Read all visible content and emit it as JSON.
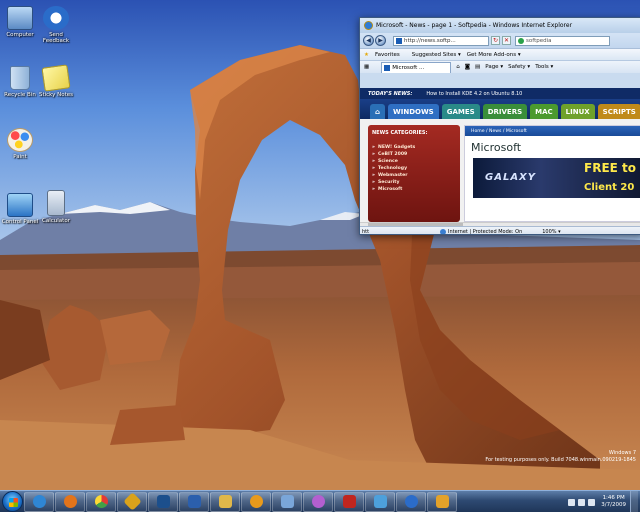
{
  "desktop": {
    "icons": [
      {
        "label": "Computer",
        "icon": "computer-icon"
      },
      {
        "label": "Send Feedback",
        "icon": "feedback-icon"
      },
      {
        "label": "Recycle Bin",
        "icon": "recycle-bin-icon"
      },
      {
        "label": "Sticky Notes",
        "icon": "sticky-notes-icon"
      },
      {
        "label": "Paint",
        "icon": "paint-icon"
      },
      {
        "label": "Control Panel",
        "icon": "control-panel-icon"
      },
      {
        "label": "Calculator",
        "icon": "calculator-icon"
      }
    ],
    "watermark": {
      "line1": "Windows 7",
      "line2": "For testing purposes only. Build 7048.winmain.090219-1845"
    }
  },
  "ie": {
    "title": "Microsoft - News - page 1 - Softpedia - Windows Internet Explorer",
    "address": "http://news.softp...",
    "search_text": "softpedia",
    "favorites_label": "Favorites",
    "suggested_sites": "Suggested Sites ▾",
    "get_addons": "Get More Add-ons ▾",
    "tab_label": "Microsoft ...",
    "page_menu": "Page ▾",
    "safety_menu": "Safety ▾",
    "tools_menu": "Tools ▾",
    "status_left": "htt",
    "status_zone": "Internet | Protected Mode: On",
    "zoom": "100% ▾"
  },
  "page": {
    "todays_news_label": "TODAY'S NEWS:",
    "headline": "How to Install KDE 4.2 on Ubuntu 8.10",
    "tabs": [
      {
        "label": "⌂",
        "color": "#2a6fb6"
      },
      {
        "label": "WINDOWS",
        "color": "#2f6fc3"
      },
      {
        "label": "GAMES",
        "color": "#2a8a88"
      },
      {
        "label": "DRIVERS",
        "color": "#3a8e3a"
      },
      {
        "label": "MAC",
        "color": "#4b9a2e"
      },
      {
        "label": "LINUX",
        "color": "#6fa12a"
      },
      {
        "label": "SCRIPTS",
        "color": "#c08a1a"
      }
    ],
    "categories_title": "NEWS CATEGORIES:",
    "categories": [
      "NEW! Gadgets",
      "CeBIT 2009",
      "Science",
      "Technology",
      "Webmaster",
      "Security",
      "Microsoft"
    ],
    "breadcrumb": "Home  /  News  /  Microsoft",
    "heading": "Microsoft",
    "ad": {
      "galaxy": "GALAXY",
      "free": "FREE to",
      "client": "Client 20"
    }
  },
  "taskbar": {
    "apps": [
      {
        "name": "internet-explorer",
        "color": "#2f86d4"
      },
      {
        "name": "firefox",
        "color": "#e2741b"
      },
      {
        "name": "chrome",
        "color": "#4caf50"
      },
      {
        "name": "winamp",
        "color": "#d9a21b"
      },
      {
        "name": "photoshop",
        "color": "#1c4f8c"
      },
      {
        "name": "word",
        "color": "#2b5fad"
      },
      {
        "name": "explorer",
        "color": "#e0b84a"
      },
      {
        "name": "media-player",
        "color": "#e89a1c"
      },
      {
        "name": "virtual-pc",
        "color": "#7aa6d9"
      },
      {
        "name": "messenger",
        "color": "#b35fd0"
      },
      {
        "name": "filezilla",
        "color": "#c0261f"
      },
      {
        "name": "remote-desktop",
        "color": "#4da0dc"
      },
      {
        "name": "help",
        "color": "#2b6cc9"
      },
      {
        "name": "media-center",
        "color": "#e3a22a"
      }
    ],
    "time": "1:46 PM",
    "date": "3/7/2009"
  }
}
